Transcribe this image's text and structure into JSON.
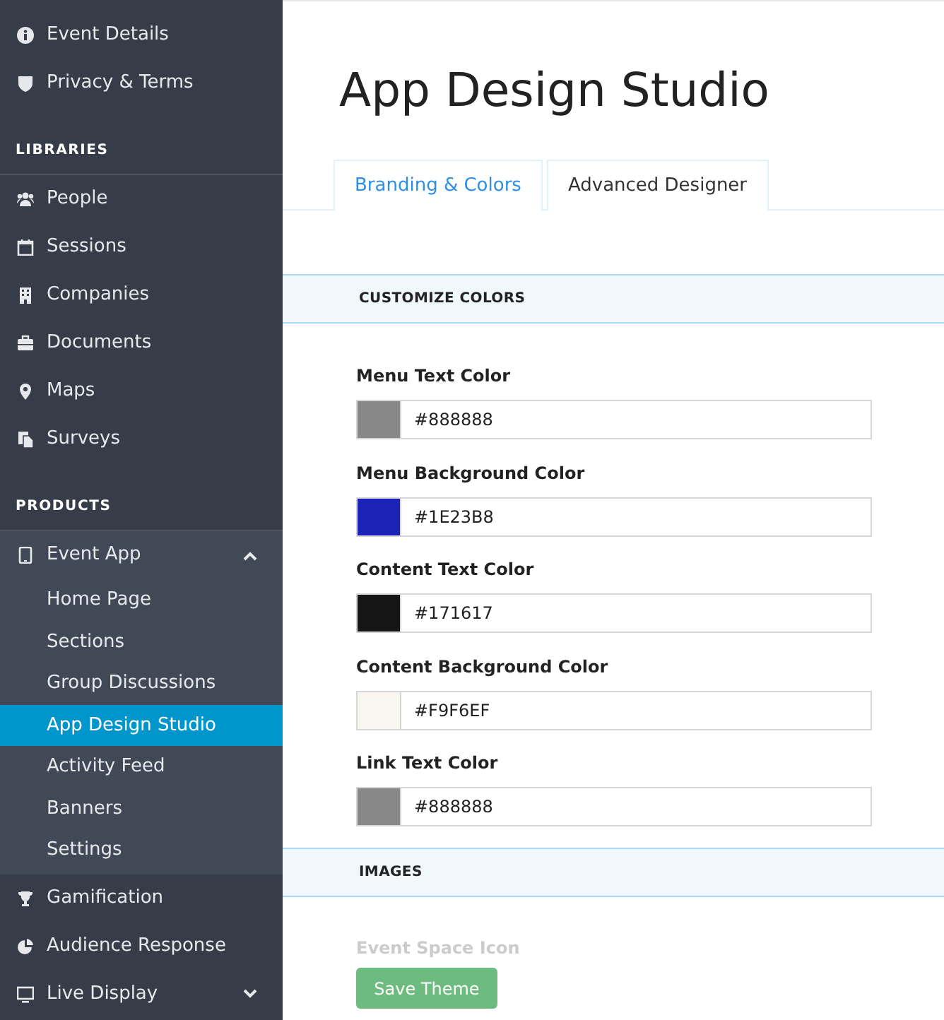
{
  "sidebar": {
    "top_items": [
      {
        "label": "Event Details"
      },
      {
        "label": "Privacy & Terms"
      }
    ],
    "sections": [
      {
        "heading": "LIBRARIES",
        "items": [
          {
            "label": "People"
          },
          {
            "label": "Sessions"
          },
          {
            "label": "Companies"
          },
          {
            "label": "Documents"
          },
          {
            "label": "Maps"
          },
          {
            "label": "Surveys"
          }
        ]
      },
      {
        "heading": "PRODUCTS",
        "items": [
          {
            "label": "Event App",
            "expanded": true,
            "children": [
              {
                "label": "Home Page",
                "selected": false
              },
              {
                "label": "Sections",
                "selected": false
              },
              {
                "label": "Group Discussions",
                "selected": false
              },
              {
                "label": "App Design Studio",
                "selected": true
              },
              {
                "label": "Activity Feed",
                "selected": false
              },
              {
                "label": "Banners",
                "selected": false
              },
              {
                "label": "Settings",
                "selected": false
              }
            ]
          },
          {
            "label": "Gamification"
          },
          {
            "label": "Audience Response"
          },
          {
            "label": "Live Display",
            "expanded": false
          }
        ]
      }
    ]
  },
  "page_title": "App Design Studio",
  "tabs": [
    {
      "label": "Branding & Colors",
      "selected": true
    },
    {
      "label": "Advanced Designer",
      "selected": false
    }
  ],
  "customize_colors": {
    "heading": "CUSTOMIZE COLORS",
    "fields": [
      {
        "label": "Menu Text Color",
        "value": "#888888",
        "color": "#888888"
      },
      {
        "label": "Menu Background Color",
        "value": "#1E23B8",
        "color": "#1e23b8"
      },
      {
        "label": "Content Text Color",
        "value": "#171617",
        "color": "#171617"
      },
      {
        "label": "Content Background Color",
        "value": "#F9F6EF",
        "color": "#f9f6ef"
      },
      {
        "label": "Link Text Color",
        "value": "#888888",
        "color": "#888888"
      }
    ]
  },
  "images": {
    "heading": "IMAGES",
    "field_label": "Event Space Icon"
  },
  "save_button": "Save Theme"
}
